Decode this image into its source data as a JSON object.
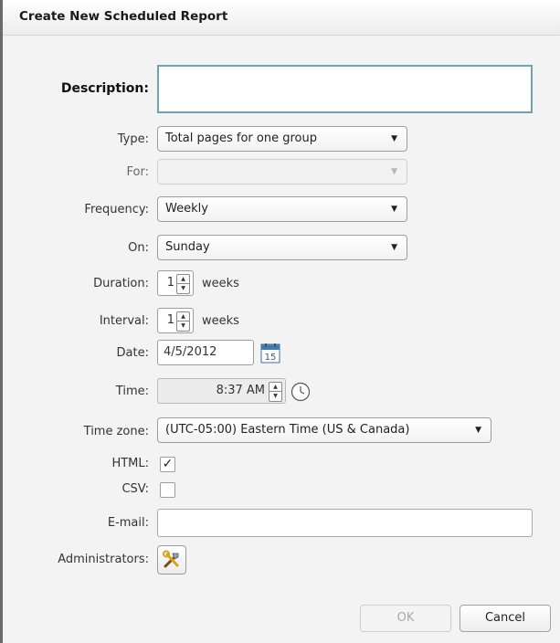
{
  "dialog": {
    "title": "Create New Scheduled Report"
  },
  "labels": {
    "description": "Description:",
    "type": "Type:",
    "for": "For:",
    "frequency": "Frequency:",
    "on": "On:",
    "duration": "Duration:",
    "interval": "Interval:",
    "date": "Date:",
    "time": "Time:",
    "time_zone": "Time zone:",
    "html": "HTML:",
    "csv": "CSV:",
    "email": "E-mail:",
    "administrators": "Administrators:"
  },
  "fields": {
    "description": "",
    "type": "Total pages for one group",
    "for": "",
    "frequency": "Weekly",
    "on": "Sunday",
    "duration": "1",
    "duration_unit": "weeks",
    "interval": "1",
    "interval_unit": "weeks",
    "date": "4/5/2012",
    "calendar_day": "15",
    "time": "8:37 AM",
    "time_zone": "(UTC-05:00) Eastern Time (US & Canada)",
    "html_checked": true,
    "csv_checked": false,
    "email": ""
  },
  "icons": {
    "dropdown": "chevron-down-icon",
    "calendar": "calendar-icon",
    "clock": "clock-icon",
    "administrators": "tools-icon",
    "check_mark": "✓"
  },
  "buttons": {
    "ok": "OK",
    "cancel": "Cancel"
  },
  "colors": {
    "focus_border": "#6fa3b2",
    "background": "#f3f3f3"
  }
}
